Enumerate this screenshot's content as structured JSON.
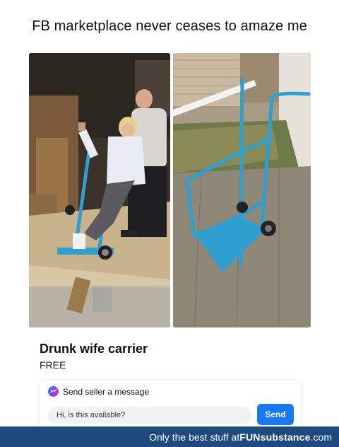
{
  "caption": "FB marketplace never ceases to amaze me",
  "listing": {
    "title": "Drunk wife carrier",
    "price": "FREE"
  },
  "message": {
    "header": "Send seller a message",
    "input_value": "Hi, is this available?",
    "send_label": "Send"
  },
  "footer": {
    "text": "Only the best stuff at ",
    "brand": "FUNsubstance",
    "suffix": ".com"
  },
  "colors": {
    "accent": "#1877f2",
    "footer_bg": "#1e4a80",
    "cart_blue": "#2f9fd0"
  },
  "icons": {
    "messenger": "messenger-icon"
  }
}
